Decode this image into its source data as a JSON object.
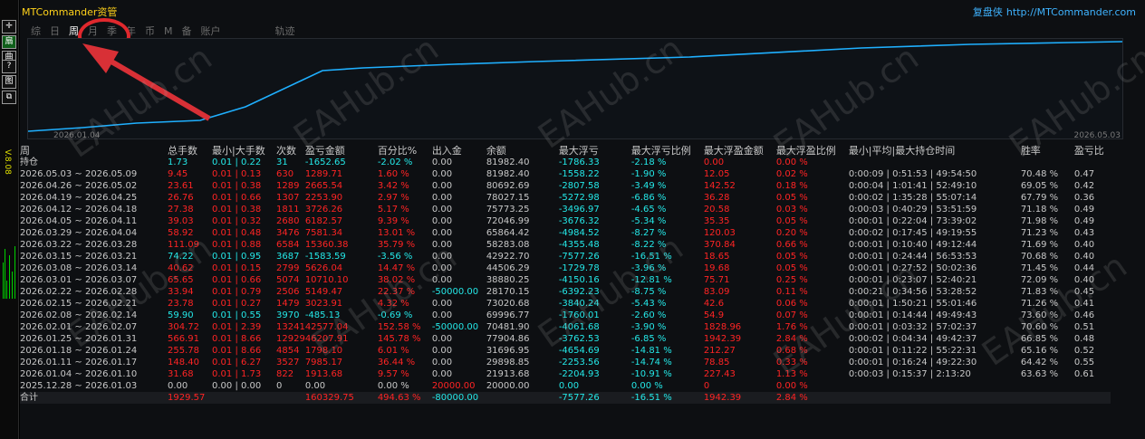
{
  "app": {
    "title": "MTCommander资管",
    "brand_cn": "复盘侠",
    "brand_url": "http://MTCommander.com"
  },
  "left_strip": {
    "buttons": [
      "✛",
      "扇",
      "曲",
      "?",
      "图",
      "⧉"
    ],
    "version": "V.8.08"
  },
  "tabs": [
    {
      "label": "综",
      "active": false
    },
    {
      "label": "日",
      "active": false
    },
    {
      "label": "周",
      "active": true
    },
    {
      "label": "月",
      "active": false
    },
    {
      "label": "季",
      "active": false
    },
    {
      "label": "年",
      "active": false
    },
    {
      "label": "币",
      "active": false
    },
    {
      "label": "M",
      "active": false
    },
    {
      "label": "备",
      "active": false
    },
    {
      "label": "账户",
      "active": false
    },
    {
      "label": "轨迹",
      "active": false
    }
  ],
  "chart": {
    "x_start_label": "2026.01.04",
    "x_end_label": "2026.05.03",
    "line_color": "#1fb0ff"
  },
  "table": {
    "headers": [
      "周",
      "总手数",
      "最小|大手数",
      "次数",
      "盈亏金额",
      "百分比%",
      "出入金",
      "余额",
      "最大浮亏",
      "最大浮亏比例",
      "最大浮盈金额",
      "最大浮盈比例",
      "最小|平均|最大持仓时间",
      "胜率",
      "盈亏比"
    ],
    "holding": {
      "label": "持仓",
      "lots": "1.73",
      "minmax": "0.01 | 0.22",
      "count": "31",
      "pnl": "-1652.65",
      "pct": "-2.02 %",
      "flow": "0.00",
      "balance": "81982.40",
      "max_dd": "-1786.33",
      "max_dd_pct": "-2.18 %",
      "max_fp": "0.00",
      "max_fp_pct": "0.00 %",
      "times": "",
      "win": "",
      "rr": ""
    },
    "rows": [
      {
        "week": "2026.05.03 ~ 2026.05.09",
        "lots": "9.45",
        "minmax": "0.01 | 0.13",
        "count": "630",
        "pnl": "1289.71",
        "pct": "1.60 %",
        "flow": "0.00",
        "balance": "81982.40",
        "max_dd": "-1558.22",
        "max_dd_pct": "-1.90 %",
        "max_fp": "12.05",
        "max_fp_pct": "0.02 %",
        "times": "0:00:09 | 0:51:53 | 49:54:50",
        "win": "70.48 %",
        "rr": "0.47"
      },
      {
        "week": "2026.04.26 ~ 2026.05.02",
        "lots": "23.61",
        "minmax": "0.01 | 0.38",
        "count": "1289",
        "pnl": "2665.54",
        "pct": "3.42 %",
        "flow": "0.00",
        "balance": "80692.69",
        "max_dd": "-2807.58",
        "max_dd_pct": "-3.49 %",
        "max_fp": "142.52",
        "max_fp_pct": "0.18 %",
        "times": "0:00:04 | 1:01:41 | 52:49:10",
        "win": "69.05 %",
        "rr": "0.42"
      },
      {
        "week": "2026.04.19 ~ 2026.04.25",
        "lots": "26.76",
        "minmax": "0.01 | 0.66",
        "count": "1307",
        "pnl": "2253.90",
        "pct": "2.97 %",
        "flow": "0.00",
        "balance": "78027.15",
        "max_dd": "-5272.98",
        "max_dd_pct": "-6.86 %",
        "max_fp": "36.28",
        "max_fp_pct": "0.05 %",
        "times": "0:00:02 | 1:35:28 | 55:07:14",
        "win": "67.79 %",
        "rr": "0.36"
      },
      {
        "week": "2026.04.12 ~ 2026.04.18",
        "lots": "27.38",
        "minmax": "0.01 | 0.38",
        "count": "1811",
        "pnl": "3726.26",
        "pct": "5.17 %",
        "flow": "0.00",
        "balance": "75773.25",
        "max_dd": "-3496.97",
        "max_dd_pct": "-4.65 %",
        "max_fp": "20.58",
        "max_fp_pct": "0.03 %",
        "times": "0:00:03 | 0:40:29 | 53:51:59",
        "win": "71.18 %",
        "rr": "0.49"
      },
      {
        "week": "2026.04.05 ~ 2026.04.11",
        "lots": "39.03",
        "minmax": "0.01 | 0.32",
        "count": "2680",
        "pnl": "6182.57",
        "pct": "9.39 %",
        "flow": "0.00",
        "balance": "72046.99",
        "max_dd": "-3676.32",
        "max_dd_pct": "-5.34 %",
        "max_fp": "35.35",
        "max_fp_pct": "0.05 %",
        "times": "0:00:01 | 0:22:04 | 73:39:02",
        "win": "71.98 %",
        "rr": "0.49"
      },
      {
        "week": "2026.03.29 ~ 2026.04.04",
        "lots": "58.92",
        "minmax": "0.01 | 0.48",
        "count": "3476",
        "pnl": "7581.34",
        "pct": "13.01 %",
        "flow": "0.00",
        "balance": "65864.42",
        "max_dd": "-4984.52",
        "max_dd_pct": "-8.27 %",
        "max_fp": "120.03",
        "max_fp_pct": "0.20 %",
        "times": "0:00:02 | 0:17:45 | 49:19:55",
        "win": "71.23 %",
        "rr": "0.43"
      },
      {
        "week": "2026.03.22 ~ 2026.03.28",
        "lots": "111.09",
        "minmax": "0.01 | 0.88",
        "count": "6584",
        "pnl": "15360.38",
        "pct": "35.79 %",
        "flow": "0.00",
        "balance": "58283.08",
        "max_dd": "-4355.48",
        "max_dd_pct": "-8.22 %",
        "max_fp": "370.84",
        "max_fp_pct": "0.66 %",
        "times": "0:00:01 | 0:10:40 | 49:12:44",
        "win": "71.69 %",
        "rr": "0.40"
      },
      {
        "week": "2026.03.15 ~ 2026.03.21",
        "lots": "74.22",
        "minmax": "0.01 | 0.95",
        "count": "3687",
        "pnl": "-1583.59",
        "pct": "-3.56 %",
        "flow": "0.00",
        "balance": "42922.70",
        "max_dd": "-7577.26",
        "max_dd_pct": "-16.51 %",
        "max_fp": "18.65",
        "max_fp_pct": "0.05 %",
        "times": "0:00:01 | 0:24:44 | 56:53:53",
        "win": "70.68 %",
        "rr": "0.40"
      },
      {
        "week": "2026.03.08 ~ 2026.03.14",
        "lots": "40.62",
        "minmax": "0.01 | 0.15",
        "count": "2799",
        "pnl": "5626.04",
        "pct": "14.47 %",
        "flow": "0.00",
        "balance": "44506.29",
        "max_dd": "-1729.78",
        "max_dd_pct": "-3.96 %",
        "max_fp": "19.68",
        "max_fp_pct": "0.05 %",
        "times": "0:00:01 | 0:27:52 | 50:02:36",
        "win": "71.45 %",
        "rr": "0.44"
      },
      {
        "week": "2026.03.01 ~ 2026.03.07",
        "lots": "65.65",
        "minmax": "0.01 | 0.66",
        "count": "5074",
        "pnl": "10710.10",
        "pct": "38.02 %",
        "flow": "0.00",
        "balance": "38880.25",
        "max_dd": "-4150.16",
        "max_dd_pct": "-12.81 %",
        "max_fp": "75.71",
        "max_fp_pct": "0.25 %",
        "times": "0:00:01 | 0:23:07 | 52:40:21",
        "win": "72.09 %",
        "rr": "0.40"
      },
      {
        "week": "2026.02.22 ~ 2026.02.28",
        "lots": "33.94",
        "minmax": "0.01 | 0.79",
        "count": "2506",
        "pnl": "5149.47",
        "pct": "22.37 %",
        "flow": "-50000.00",
        "balance": "28170.15",
        "max_dd": "-6392.23",
        "max_dd_pct": "-8.75 %",
        "max_fp": "83.09",
        "max_fp_pct": "0.11 %",
        "times": "0:00:21 | 0:34:56 | 53:28:52",
        "win": "71.83 %",
        "rr": "0.45"
      },
      {
        "week": "2026.02.15 ~ 2026.02.21",
        "lots": "23.78",
        "minmax": "0.01 | 0.27",
        "count": "1479",
        "pnl": "3023.91",
        "pct": "4.32 %",
        "flow": "0.00",
        "balance": "73020.68",
        "max_dd": "-3840.24",
        "max_dd_pct": "-5.43 %",
        "max_fp": "42.6",
        "max_fp_pct": "0.06 %",
        "times": "0:00:01 | 1:50:21 | 55:01:46",
        "win": "71.26 %",
        "rr": "0.41"
      },
      {
        "week": "2026.02.08 ~ 2026.02.14",
        "lots": "59.90",
        "minmax": "0.01 | 0.55",
        "count": "3970",
        "pnl": "-485.13",
        "pct": "-0.69 %",
        "flow": "0.00",
        "balance": "69996.77",
        "max_dd": "-1760.01",
        "max_dd_pct": "-2.60 %",
        "max_fp": "54.9",
        "max_fp_pct": "0.07 %",
        "times": "0:00:01 | 0:14:44 | 49:49:43",
        "win": "73.60 %",
        "rr": "0.46"
      },
      {
        "week": "2026.02.01 ~ 2026.02.07",
        "lots": "304.72",
        "minmax": "0.01 | 2.39",
        "count": "13241",
        "pnl": "42577.04",
        "pct": "152.58 %",
        "flow": "-50000.00",
        "balance": "70481.90",
        "max_dd": "-4061.68",
        "max_dd_pct": "-3.90 %",
        "max_fp": "1828.96",
        "max_fp_pct": "1.76 %",
        "times": "0:00:01 | 0:03:32 | 57:02:37",
        "win": "70.60 %",
        "rr": "0.51"
      },
      {
        "week": "2026.01.25 ~ 2026.01.31",
        "lots": "566.91",
        "minmax": "0.01 | 8.66",
        "count": "12929",
        "pnl": "46207.91",
        "pct": "145.78 %",
        "flow": "0.00",
        "balance": "77904.86",
        "max_dd": "-3762.53",
        "max_dd_pct": "-6.85 %",
        "max_fp": "1942.39",
        "max_fp_pct": "2.84 %",
        "times": "0:00:02 | 0:04:34 | 49:42:37",
        "win": "66.85 %",
        "rr": "0.48"
      },
      {
        "week": "2026.01.18 ~ 2026.01.24",
        "lots": "255.78",
        "minmax": "0.01 | 8.66",
        "count": "4854",
        "pnl": "1798.10",
        "pct": "6.01 %",
        "flow": "0.00",
        "balance": "31696.95",
        "max_dd": "-4654.69",
        "max_dd_pct": "-14.81 %",
        "max_fp": "212.27",
        "max_fp_pct": "0.68 %",
        "times": "0:00:01 | 0:11:22 | 55:22:31",
        "win": "65.16 %",
        "rr": "0.52"
      },
      {
        "week": "2026.01.11 ~ 2026.01.17",
        "lots": "148.40",
        "minmax": "0.01 | 6.27",
        "count": "3527",
        "pnl": "7985.17",
        "pct": "36.44 %",
        "flow": "0.00",
        "balance": "29898.85",
        "max_dd": "-2253.56",
        "max_dd_pct": "-14.74 %",
        "max_fp": "78.85",
        "max_fp_pct": "0.33 %",
        "times": "0:00:01 | 0:16:24 | 49:22:30",
        "win": "64.42 %",
        "rr": "0.55"
      },
      {
        "week": "2026.01.04 ~ 2026.01.10",
        "lots": "31.68",
        "minmax": "0.01 | 1.73",
        "count": "822",
        "pnl": "1913.68",
        "pct": "9.57 %",
        "flow": "0.00",
        "balance": "21913.68",
        "max_dd": "-2204.93",
        "max_dd_pct": "-10.91 %",
        "max_fp": "227.43",
        "max_fp_pct": "1.13 %",
        "times": "0:00:03 | 0:15:37 | 2:13:20",
        "win": "63.63 %",
        "rr": "0.61"
      },
      {
        "week": "2025.12.28 ~ 2026.01.03",
        "lots": "0.00",
        "minmax": "0.00 | 0.00",
        "count": "0",
        "pnl": "0.00",
        "pct": "0.00 %",
        "flow": "20000.00",
        "balance": "20000.00",
        "max_dd": "0.00",
        "max_dd_pct": "0.00 %",
        "max_fp": "0",
        "max_fp_pct": "0.00 %",
        "times": "",
        "win": "",
        "rr": ""
      }
    ],
    "total": {
      "label": "合计",
      "lots": "1929.57",
      "minmax": "",
      "count": "",
      "pnl": "160329.75",
      "pct": "494.63 %",
      "flow": "-80000.00",
      "balance": "",
      "max_dd": "-7577.26",
      "max_dd_pct": "-16.51 %",
      "max_fp": "1942.39",
      "max_fp_pct": "2.84 %",
      "times": "",
      "win": "",
      "rr": ""
    }
  },
  "watermark": "EAHub.cn"
}
